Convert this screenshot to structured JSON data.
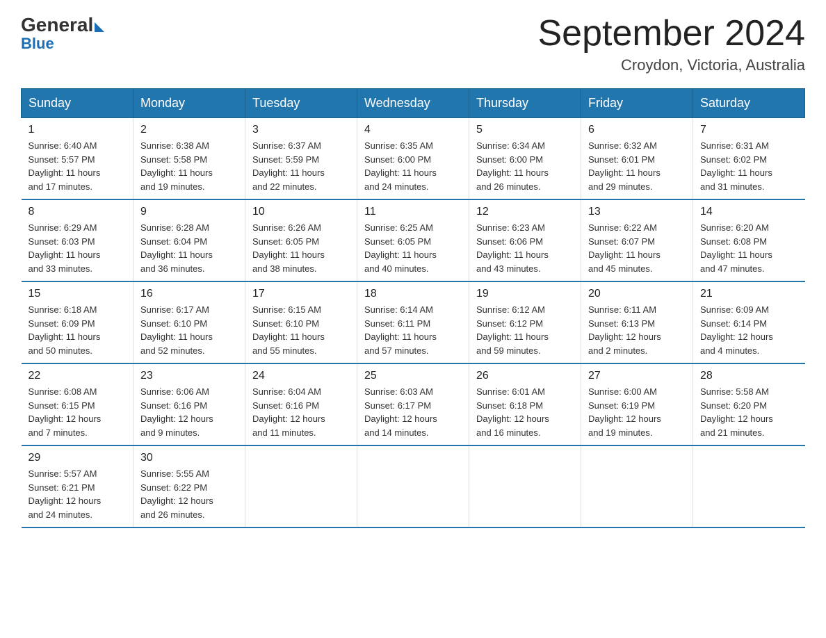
{
  "header": {
    "logo_general": "General",
    "logo_blue": "Blue",
    "month_title": "September 2024",
    "location": "Croydon, Victoria, Australia"
  },
  "weekdays": [
    "Sunday",
    "Monday",
    "Tuesday",
    "Wednesday",
    "Thursday",
    "Friday",
    "Saturday"
  ],
  "weeks": [
    [
      {
        "day": "1",
        "sunrise": "6:40 AM",
        "sunset": "5:57 PM",
        "daylight": "11 hours and 17 minutes."
      },
      {
        "day": "2",
        "sunrise": "6:38 AM",
        "sunset": "5:58 PM",
        "daylight": "11 hours and 19 minutes."
      },
      {
        "day": "3",
        "sunrise": "6:37 AM",
        "sunset": "5:59 PM",
        "daylight": "11 hours and 22 minutes."
      },
      {
        "day": "4",
        "sunrise": "6:35 AM",
        "sunset": "6:00 PM",
        "daylight": "11 hours and 24 minutes."
      },
      {
        "day": "5",
        "sunrise": "6:34 AM",
        "sunset": "6:00 PM",
        "daylight": "11 hours and 26 minutes."
      },
      {
        "day": "6",
        "sunrise": "6:32 AM",
        "sunset": "6:01 PM",
        "daylight": "11 hours and 29 minutes."
      },
      {
        "day": "7",
        "sunrise": "6:31 AM",
        "sunset": "6:02 PM",
        "daylight": "11 hours and 31 minutes."
      }
    ],
    [
      {
        "day": "8",
        "sunrise": "6:29 AM",
        "sunset": "6:03 PM",
        "daylight": "11 hours and 33 minutes."
      },
      {
        "day": "9",
        "sunrise": "6:28 AM",
        "sunset": "6:04 PM",
        "daylight": "11 hours and 36 minutes."
      },
      {
        "day": "10",
        "sunrise": "6:26 AM",
        "sunset": "6:05 PM",
        "daylight": "11 hours and 38 minutes."
      },
      {
        "day": "11",
        "sunrise": "6:25 AM",
        "sunset": "6:05 PM",
        "daylight": "11 hours and 40 minutes."
      },
      {
        "day": "12",
        "sunrise": "6:23 AM",
        "sunset": "6:06 PM",
        "daylight": "11 hours and 43 minutes."
      },
      {
        "day": "13",
        "sunrise": "6:22 AM",
        "sunset": "6:07 PM",
        "daylight": "11 hours and 45 minutes."
      },
      {
        "day": "14",
        "sunrise": "6:20 AM",
        "sunset": "6:08 PM",
        "daylight": "11 hours and 47 minutes."
      }
    ],
    [
      {
        "day": "15",
        "sunrise": "6:18 AM",
        "sunset": "6:09 PM",
        "daylight": "11 hours and 50 minutes."
      },
      {
        "day": "16",
        "sunrise": "6:17 AM",
        "sunset": "6:10 PM",
        "daylight": "11 hours and 52 minutes."
      },
      {
        "day": "17",
        "sunrise": "6:15 AM",
        "sunset": "6:10 PM",
        "daylight": "11 hours and 55 minutes."
      },
      {
        "day": "18",
        "sunrise": "6:14 AM",
        "sunset": "6:11 PM",
        "daylight": "11 hours and 57 minutes."
      },
      {
        "day": "19",
        "sunrise": "6:12 AM",
        "sunset": "6:12 PM",
        "daylight": "11 hours and 59 minutes."
      },
      {
        "day": "20",
        "sunrise": "6:11 AM",
        "sunset": "6:13 PM",
        "daylight": "12 hours and 2 minutes."
      },
      {
        "day": "21",
        "sunrise": "6:09 AM",
        "sunset": "6:14 PM",
        "daylight": "12 hours and 4 minutes."
      }
    ],
    [
      {
        "day": "22",
        "sunrise": "6:08 AM",
        "sunset": "6:15 PM",
        "daylight": "12 hours and 7 minutes."
      },
      {
        "day": "23",
        "sunrise": "6:06 AM",
        "sunset": "6:16 PM",
        "daylight": "12 hours and 9 minutes."
      },
      {
        "day": "24",
        "sunrise": "6:04 AM",
        "sunset": "6:16 PM",
        "daylight": "12 hours and 11 minutes."
      },
      {
        "day": "25",
        "sunrise": "6:03 AM",
        "sunset": "6:17 PM",
        "daylight": "12 hours and 14 minutes."
      },
      {
        "day": "26",
        "sunrise": "6:01 AM",
        "sunset": "6:18 PM",
        "daylight": "12 hours and 16 minutes."
      },
      {
        "day": "27",
        "sunrise": "6:00 AM",
        "sunset": "6:19 PM",
        "daylight": "12 hours and 19 minutes."
      },
      {
        "day": "28",
        "sunrise": "5:58 AM",
        "sunset": "6:20 PM",
        "daylight": "12 hours and 21 minutes."
      }
    ],
    [
      {
        "day": "29",
        "sunrise": "5:57 AM",
        "sunset": "6:21 PM",
        "daylight": "12 hours and 24 minutes."
      },
      {
        "day": "30",
        "sunrise": "5:55 AM",
        "sunset": "6:22 PM",
        "daylight": "12 hours and 26 minutes."
      },
      null,
      null,
      null,
      null,
      null
    ]
  ]
}
